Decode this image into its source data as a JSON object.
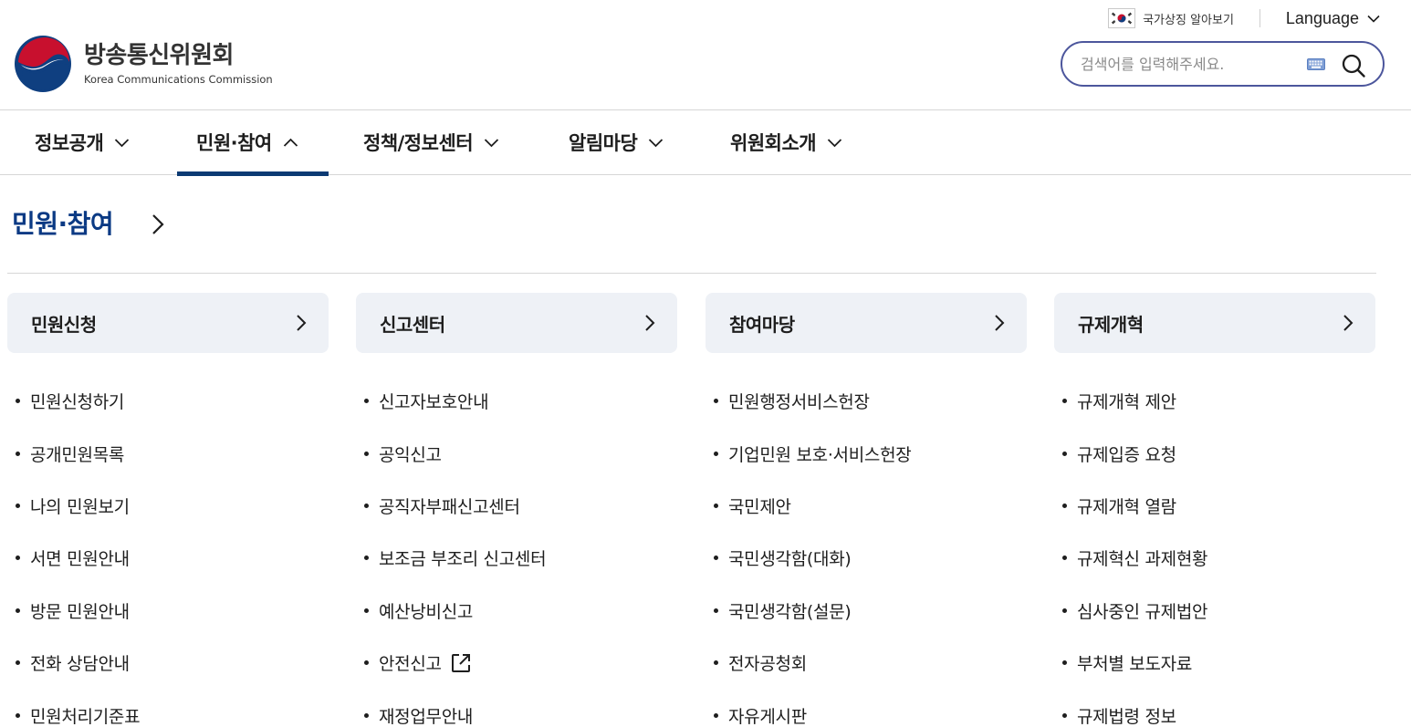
{
  "header": {
    "logo_kr": "방송통신위원회",
    "logo_en": "Korea Communications Commission",
    "national_symbol_label": "국가상징 알아보기",
    "language_label": "Language",
    "search_placeholder": "검색어를 입력해주세요."
  },
  "gnb": [
    {
      "label": "정보공개",
      "expanded": false
    },
    {
      "label": "민원·참여",
      "expanded": true
    },
    {
      "label": "정책/정보센터",
      "expanded": false
    },
    {
      "label": "알림마당",
      "expanded": false
    },
    {
      "label": "위원회소개",
      "expanded": false
    }
  ],
  "panel": {
    "title": "민원·참여",
    "columns": [
      {
        "heading": "민원신청",
        "items": [
          "민원신청하기",
          "공개민원목록",
          "나의 민원보기",
          "서면 민원안내",
          "방문 민원안내",
          "전화 상담안내",
          "민원처리기준표"
        ]
      },
      {
        "heading": "신고센터",
        "items": [
          "신고자보호안내",
          "공익신고",
          "공직자부패신고센터",
          "보조금 부조리 신고센터",
          "예산낭비신고",
          "안전신고",
          "재정업무안내"
        ]
      },
      {
        "heading": "참여마당",
        "items": [
          "민원행정서비스헌장",
          "기업민원 보호·서비스헌장",
          "국민제안",
          "국민생각함(대화)",
          "국민생각함(설문)",
          "전자공청회",
          "자유게시판"
        ]
      },
      {
        "heading": "규제개혁",
        "items": [
          "규제개혁 제안",
          "규제입증 요청",
          "규제개혁 열람",
          "규제혁신 과제현황",
          "심사중인 규제법안",
          "부처별 보도자료",
          "규제법령 정보"
        ]
      }
    ]
  },
  "colors": {
    "accent_navy": "#0b3a73",
    "title_blue": "#0b3a84",
    "search_border": "#4c569c",
    "column_head_bg": "#eef1f6"
  }
}
